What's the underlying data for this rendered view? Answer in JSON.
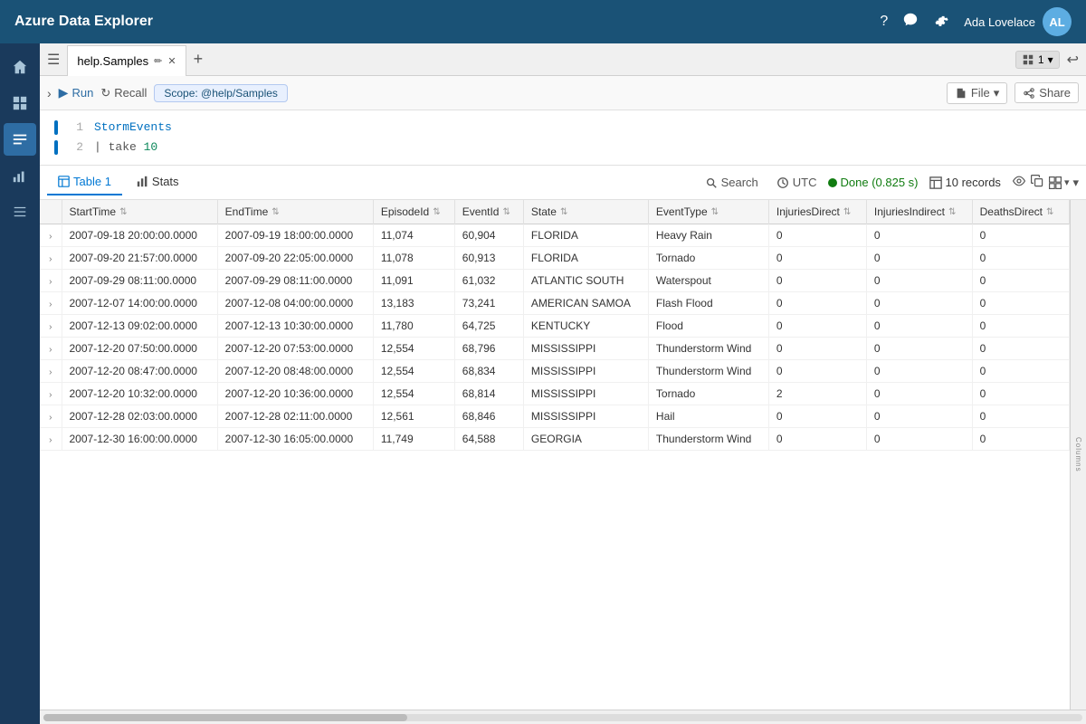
{
  "app": {
    "title": "Azure Data Explorer"
  },
  "topbar": {
    "title": "Azure Data Explorer",
    "help_icon": "?",
    "feedback_icon": "💬",
    "settings_icon": "⚙",
    "user_name": "Ada Lovelace"
  },
  "sidebar": {
    "items": [
      {
        "id": "home",
        "icon": "⌂",
        "active": false
      },
      {
        "id": "data",
        "icon": "◫",
        "active": false
      },
      {
        "id": "query",
        "icon": "≡",
        "active": true
      },
      {
        "id": "chart",
        "icon": "📊",
        "active": false
      },
      {
        "id": "settings",
        "icon": "⊞",
        "active": false
      }
    ]
  },
  "tab": {
    "label": "help.Samples",
    "counter": "1",
    "add_label": "+"
  },
  "toolbar": {
    "run_label": "Run",
    "recall_label": "Recall",
    "scope_label": "Scope: @help/Samples",
    "file_label": "File",
    "share_label": "Share"
  },
  "editor": {
    "lines": [
      {
        "number": "1",
        "content": "StormEvents",
        "type": "keyword"
      },
      {
        "number": "2",
        "content": "| take 10",
        "type": "operator"
      }
    ]
  },
  "results": {
    "tab1_label": "Table 1",
    "tab2_label": "Stats",
    "search_label": "Search",
    "utc_label": "UTC",
    "status_label": "Done (0.825 s)",
    "records_label": "10 records",
    "columns_label": "Columns"
  },
  "table": {
    "columns": [
      "StartTime",
      "EndTime",
      "EpisodeId",
      "EventId",
      "State",
      "EventType",
      "InjuriesDirect",
      "InjuriesIndirect",
      "DeathsDirect"
    ],
    "rows": [
      {
        "StartTime": "2007-09-18 20:00:00.0000",
        "EndTime": "2007-09-19 18:00:00.0000",
        "EpisodeId": "11,074",
        "EventId": "60,904",
        "State": "FLORIDA",
        "EventType": "Heavy Rain",
        "InjuriesDirect": "0",
        "InjuriesIndirect": "0",
        "DeathsDirect": "0"
      },
      {
        "StartTime": "2007-09-20 21:57:00.0000",
        "EndTime": "2007-09-20 22:05:00.0000",
        "EpisodeId": "11,078",
        "EventId": "60,913",
        "State": "FLORIDA",
        "EventType": "Tornado",
        "InjuriesDirect": "0",
        "InjuriesIndirect": "0",
        "DeathsDirect": "0"
      },
      {
        "StartTime": "2007-09-29 08:11:00.0000",
        "EndTime": "2007-09-29 08:11:00.0000",
        "EpisodeId": "11,091",
        "EventId": "61,032",
        "State": "ATLANTIC SOUTH",
        "EventType": "Waterspout",
        "InjuriesDirect": "0",
        "InjuriesIndirect": "0",
        "DeathsDirect": "0"
      },
      {
        "StartTime": "2007-12-07 14:00:00.0000",
        "EndTime": "2007-12-08 04:00:00.0000",
        "EpisodeId": "13,183",
        "EventId": "73,241",
        "State": "AMERICAN SAMOA",
        "EventType": "Flash Flood",
        "InjuriesDirect": "0",
        "InjuriesIndirect": "0",
        "DeathsDirect": "0"
      },
      {
        "StartTime": "2007-12-13 09:02:00.0000",
        "EndTime": "2007-12-13 10:30:00.0000",
        "EpisodeId": "11,780",
        "EventId": "64,725",
        "State": "KENTUCKY",
        "EventType": "Flood",
        "InjuriesDirect": "0",
        "InjuriesIndirect": "0",
        "DeathsDirect": "0"
      },
      {
        "StartTime": "2007-12-20 07:50:00.0000",
        "EndTime": "2007-12-20 07:53:00.0000",
        "EpisodeId": "12,554",
        "EventId": "68,796",
        "State": "MISSISSIPPI",
        "EventType": "Thunderstorm Wind",
        "InjuriesDirect": "0",
        "InjuriesIndirect": "0",
        "DeathsDirect": "0"
      },
      {
        "StartTime": "2007-12-20 08:47:00.0000",
        "EndTime": "2007-12-20 08:48:00.0000",
        "EpisodeId": "12,554",
        "EventId": "68,834",
        "State": "MISSISSIPPI",
        "EventType": "Thunderstorm Wind",
        "InjuriesDirect": "0",
        "InjuriesIndirect": "0",
        "DeathsDirect": "0"
      },
      {
        "StartTime": "2007-12-20 10:32:00.0000",
        "EndTime": "2007-12-20 10:36:00.0000",
        "EpisodeId": "12,554",
        "EventId": "68,814",
        "State": "MISSISSIPPI",
        "EventType": "Tornado",
        "InjuriesDirect": "2",
        "InjuriesIndirect": "0",
        "DeathsDirect": "0"
      },
      {
        "StartTime": "2007-12-28 02:03:00.0000",
        "EndTime": "2007-12-28 02:11:00.0000",
        "EpisodeId": "12,561",
        "EventId": "68,846",
        "State": "MISSISSIPPI",
        "EventType": "Hail",
        "InjuriesDirect": "0",
        "InjuriesIndirect": "0",
        "DeathsDirect": "0"
      },
      {
        "StartTime": "2007-12-30 16:00:00.0000",
        "EndTime": "2007-12-30 16:05:00.0000",
        "EpisodeId": "11,749",
        "EventId": "64,588",
        "State": "GEORGIA",
        "EventType": "Thunderstorm Wind",
        "InjuriesDirect": "0",
        "InjuriesIndirect": "0",
        "DeathsDirect": "0"
      }
    ]
  }
}
